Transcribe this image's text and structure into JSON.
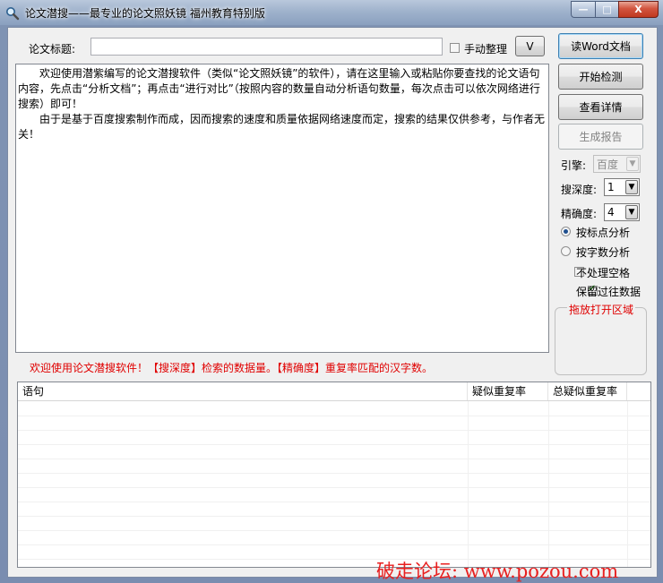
{
  "window": {
    "title": "论文潜搜——最专业的论文照妖镜 福州教育特别版",
    "minimize_symbol": "—",
    "maximize_symbol": "□",
    "close_symbol": "X"
  },
  "form": {
    "title_label": "论文标题:",
    "title_value": "",
    "manual_label": "手动整理",
    "expand_symbol": "V"
  },
  "main_text": {
    "paragraph1": "欢迎使用潜紫编写的论文潜搜软件（类似“论文照妖镜”的软件），请在这里输入或粘贴你要查找的论文语句内容，先点击“分析文档”；再点击“进行对比”（按照内容的数量自动分析语句数量，每次点击可以依次网络进行搜索）即可！",
    "paragraph2": "由于是基于百度搜索制作而成，因而搜索的速度和质量依据网络速度而定，搜索的结果仅供参考，与作者无关！"
  },
  "buttons": {
    "read_word": "读Word文档",
    "start_check": "开始检测",
    "view_details": "查看详情",
    "generate_report": "生成报告"
  },
  "options": {
    "engine_label": "引擎:",
    "engine_value": "百度",
    "depth_label": "搜深度:",
    "depth_value": "1",
    "precision_label": "精确度:",
    "precision_value": "4",
    "radio_punct": "按标点分析",
    "radio_chars": "按字数分析",
    "no_space_label": "不处理空格",
    "keep_data_label": "保留过往数据",
    "drop_area_label": "拖放打开区域"
  },
  "status": {
    "message": "欢迎使用论文潜搜软件！【搜深度】检索的数据量。【精确度】重复率匹配的汉字数。"
  },
  "table": {
    "columns": [
      "语句",
      "疑似重复率",
      "总疑似重复率"
    ]
  },
  "watermark": "破走论坛: www.pozou.com",
  "colors": {
    "accent_red": "#e00000",
    "window_frame": "#8aa0bf"
  }
}
